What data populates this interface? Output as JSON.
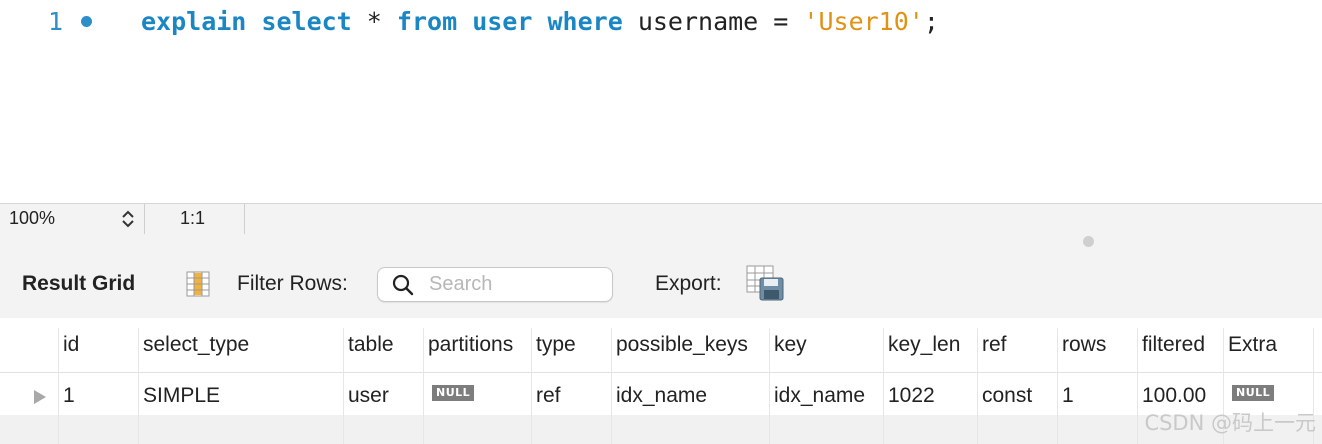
{
  "editor": {
    "line_number": "1",
    "tokens": {
      "kw1": "explain",
      "kw2": "select",
      "star": "*",
      "kw3": "from",
      "kw4": "user",
      "kw5": "where",
      "ident": "username",
      "op": "=",
      "str": "'User10'",
      "semi": ";"
    }
  },
  "status": {
    "zoom": "100%",
    "position": "1:1"
  },
  "toolbar": {
    "title": "Result Grid",
    "filter_label": "Filter Rows:",
    "search_placeholder": "Search",
    "export_label": "Export:"
  },
  "grid": {
    "columns": [
      "id",
      "select_type",
      "table",
      "partitions",
      "type",
      "possible_keys",
      "key",
      "key_len",
      "ref",
      "rows",
      "filtered",
      "Extra"
    ],
    "row": {
      "id": "1",
      "select_type": "SIMPLE",
      "table": "user",
      "partitions": "NULL",
      "type": "ref",
      "possible_keys": "idx_name",
      "key": "idx_name",
      "key_len": "1022",
      "ref": "const",
      "rows": "1",
      "filtered": "100.00",
      "extra": "NULL"
    }
  },
  "watermark": "CSDN @码上一元",
  "colors": {
    "keyword": "#1a86c4",
    "string": "#e09214",
    "gutter": "#2c8fc9",
    "null_badge": "#7d7d7d"
  }
}
